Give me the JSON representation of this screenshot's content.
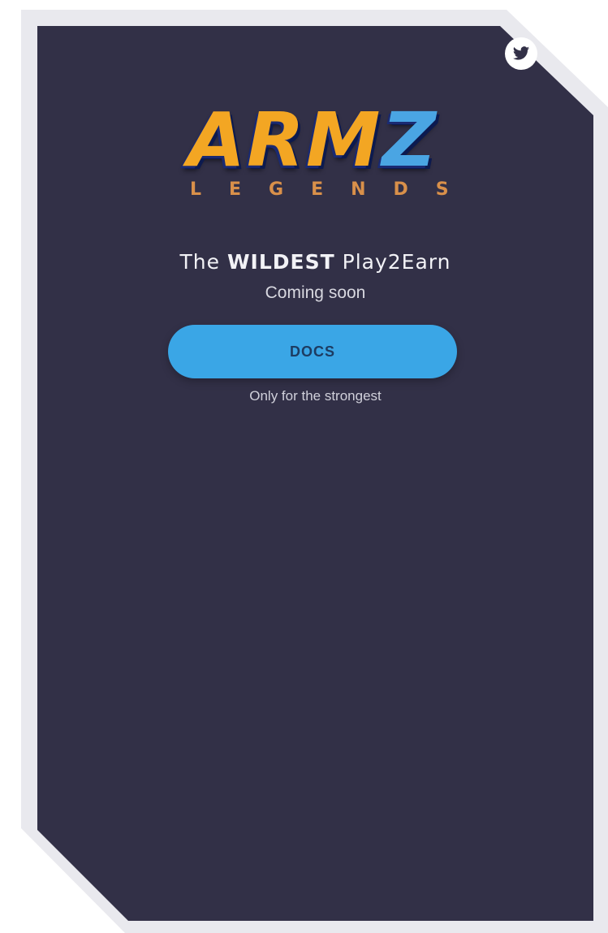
{
  "social": {
    "twitter_icon": "twitter-bird-icon"
  },
  "logo": {
    "main_gold": "ARM",
    "main_blue": "Z",
    "sub": "LEGENDS"
  },
  "headline": {
    "prefix": "The ",
    "emphasis": "WILDEST",
    "suffix": " Play2Earn"
  },
  "status": "Coming soon",
  "cta": {
    "label": "DOCS",
    "tagline": "Only for the strongest"
  },
  "colors": {
    "background": "#323047",
    "accent": "#3aa6e6",
    "logo_gold": "#f3a623",
    "logo_blue": "#4aa5e3"
  }
}
